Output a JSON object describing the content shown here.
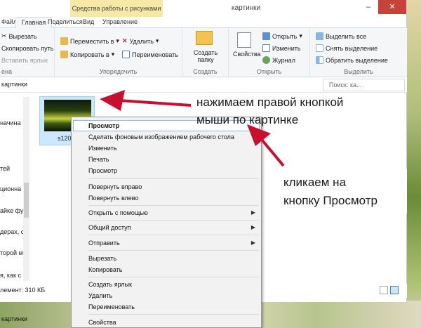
{
  "window": {
    "contextual_tab_header": "Средства работы с рисунками",
    "title": "картинки",
    "min_glyph": "–",
    "close_glyph": "✕"
  },
  "ribbon_tabs": [
    "Файл",
    "Главная",
    "Поделиться",
    "Вид",
    "Управление"
  ],
  "ribbon": {
    "clipboard": {
      "cut": "Вырезать",
      "copy_path": "Скопировать путь",
      "paste_shortcut": "Вставить ярлык",
      "label": "ена"
    },
    "organize": {
      "move_to": "Переместить в",
      "copy_to": "Копировать в",
      "delete": "Удалить",
      "rename": "Переименовать",
      "label": "Упорядочить"
    },
    "create": {
      "new_folder_line1": "Создать",
      "new_folder_line2": "папку",
      "label": "Создать"
    },
    "open": {
      "properties": "Свойства",
      "open": "Открыть",
      "edit": "Изменить",
      "history": "Журнал",
      "label": "Открыть"
    },
    "select": {
      "select_all": "Выделить все",
      "select_none": "Снять выделение",
      "invert": "Обратить выделение",
      "label": "Выделить"
    }
  },
  "address_bar": {
    "path": "картинки",
    "search_placeholder": "Поиск: ка..."
  },
  "nav_pane": [
    "",
    "начина",
    "тей",
    "ционна",
    "айке фу",
    "дерах, с",
    "торой м",
    "я, как с",
    "a"
  ],
  "file": {
    "name": "s1200."
  },
  "status_bar": {
    "text": "лемент: 310 КБ"
  },
  "context_menu": {
    "items": [
      {
        "label": "Просмотр",
        "bold": true,
        "highlighted": true
      },
      {
        "label": "Сделать фоновым изображением рабочего стола"
      },
      {
        "label": "Изменить"
      },
      {
        "label": "Печать"
      },
      {
        "label": "Просмотр"
      },
      {
        "separator": true
      },
      {
        "label": "Повернуть вправо"
      },
      {
        "label": "Повернуть влево"
      },
      {
        "separator": true
      },
      {
        "label": "Открыть с помощью",
        "submenu": true
      },
      {
        "separator": true
      },
      {
        "label": "Общий доступ",
        "submenu": true
      },
      {
        "separator": true
      },
      {
        "label": "Отправить",
        "submenu": true
      },
      {
        "separator": true
      },
      {
        "label": "Вырезать"
      },
      {
        "label": "Копировать"
      },
      {
        "separator": true
      },
      {
        "label": "Создать ярлык"
      },
      {
        "label": "Удалить"
      },
      {
        "label": "Переименовать"
      },
      {
        "separator": true
      },
      {
        "label": "Свойства"
      }
    ]
  },
  "annotations": {
    "note1_line1": "нажимаем правой кнопкой",
    "note1_line2": "мыши по картинке",
    "note2_line1": "кликаем на",
    "note2_line2": "кнопку Просмотр"
  },
  "colors": {
    "arrow": "#c8102e",
    "selection_fill": "#cce8ff",
    "contextual_tab": "#f6e9a6",
    "close_button": "#c7433a"
  },
  "bottom_left_text": "картинки"
}
